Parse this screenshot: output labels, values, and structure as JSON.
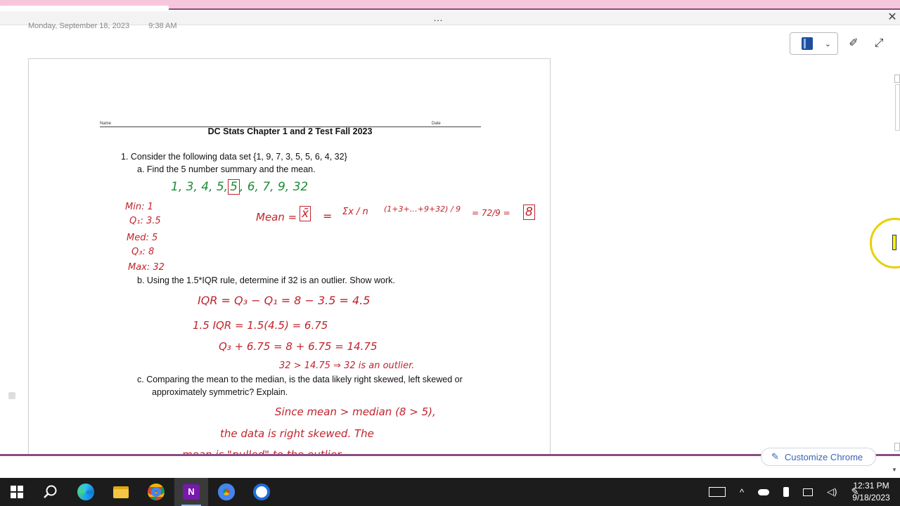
{
  "window": {
    "grip": "…",
    "close_glyph": "✕"
  },
  "note_header": {
    "date": "Monday, September 18, 2023",
    "time": "9:38 AM"
  },
  "toolbar": {
    "notebook_icon": "notebook-icon",
    "dropdown_glyph": "⌄",
    "pen_glyph": "✐",
    "expand_glyph": "⤢"
  },
  "document": {
    "name_label": "Name",
    "date_label": "Date",
    "title": "DC Stats Chapter 1 and 2 Test Fall 2023",
    "q1": "1. Consider the following data set {1, 9, 7, 3, 5, 5, 6, 4, 32}",
    "q1a": "a.   Find the 5 number summary and the mean.",
    "q1b": "b.   Using the 1.5*IQR rule, determine if 32 is an outlier. Show work.",
    "q1c_line1": "c.   Comparing the mean to the median, is the data likely right skewed, left skewed or",
    "q1c_line2": "approximately symmetric? Explain."
  },
  "handwriting": {
    "sorted_pre": "1, 3, 4, 5,",
    "sorted_box": "5",
    "sorted_post": ", 6, 7, 9, 32",
    "min": "Min: 1",
    "q1": "Q₁: 3.5",
    "med": "Med: 5",
    "q3": "Q₃: 8",
    "max": "Max: 32",
    "mean_lhs": "Mean =",
    "mean_xbar": "x̄",
    "mean_eq": "=",
    "mean_sigma": "Σx / n",
    "mean_sum": "(1+3+…+9+32) / 9",
    "mean_frac": "= 72/9 =",
    "mean_result": "8",
    "iqr": "IQR = Q₃ − Q₁ = 8 − 3.5 = 4.5",
    "iqr15": "1.5 IQR = 1.5(4.5) = 6.75",
    "fence": "Q₃ + 6.75 = 8 + 6.75 = 14.75",
    "conclusion": "32 > 14.75  ⇒  32 is an outlier.",
    "skew1": "Since mean > median (8 > 5),",
    "skew2": "the data is right skewed. The",
    "skew3": "mean is \"pulled\" to the outlier."
  },
  "chrome": {
    "customize_label": "Customize Chrome",
    "customize_icon": "pencil-icon"
  },
  "taskbar": {
    "apps": [
      {
        "name": "start",
        "icon": "windows-logo-icon"
      },
      {
        "name": "search",
        "icon": "search-icon"
      },
      {
        "name": "edge",
        "icon": "edge-icon"
      },
      {
        "name": "file-explorer",
        "icon": "folder-icon"
      },
      {
        "name": "chrome-profile",
        "icon": "chrome-icon"
      },
      {
        "name": "onenote",
        "icon": "onenote-icon",
        "active": true
      },
      {
        "name": "chrome",
        "icon": "chrome-icon"
      },
      {
        "name": "app",
        "icon": "app-icon"
      }
    ],
    "time": "12:31 PM",
    "date": "9/18/2023"
  }
}
